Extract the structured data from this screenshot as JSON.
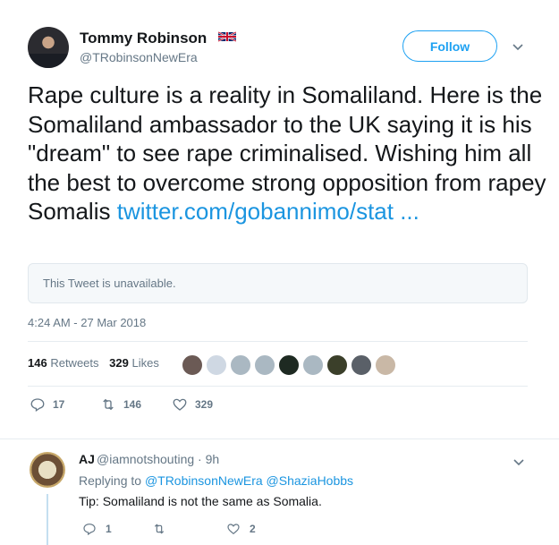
{
  "author": {
    "name": "Tommy Robinson",
    "handle": "@TRobinsonNewEra"
  },
  "follow_label": "Follow",
  "tweet": {
    "text": "Rape culture is a reality in Somaliland. Here is the Somaliland ambassador to the UK saying it is his \"dream\" to see rape criminalised. Wishing him all the best to overcome strong opposition from rapey Somalis",
    "link": "twitter.com/gobannimo/stat ...",
    "quoted_unavailable": "This Tweet is unavailable.",
    "timestamp": "4:24 AM - 27 Mar 2018"
  },
  "stats": {
    "retweets_count": "146",
    "retweets_label": "Retweets",
    "likes_count": "329",
    "likes_label": "Likes"
  },
  "actions": {
    "replies": "17",
    "retweets": "146",
    "likes": "329"
  },
  "liker_avatar_colors": [
    "#6b5a55",
    "#cfd8e3",
    "#aab8c2",
    "#aab8c2",
    "#1e2a22",
    "#aab8c2",
    "#3b3f2a",
    "#5a6068",
    "#c9b8a6"
  ],
  "reply": {
    "name": "AJ",
    "handle": "@iamnotshouting · 9h",
    "replying_prefix": "Replying to",
    "mention_1": "@TRobinsonNewEra",
    "mention_2": "@ShaziaHobbs",
    "text": "Tip: Somaliland is not the same as Somalia.",
    "replies": "1",
    "likes": "2"
  },
  "colors": {
    "accent": "#1da1f2",
    "link": "#1b95e0",
    "muted": "#657786",
    "like_red": "#e0245e"
  }
}
